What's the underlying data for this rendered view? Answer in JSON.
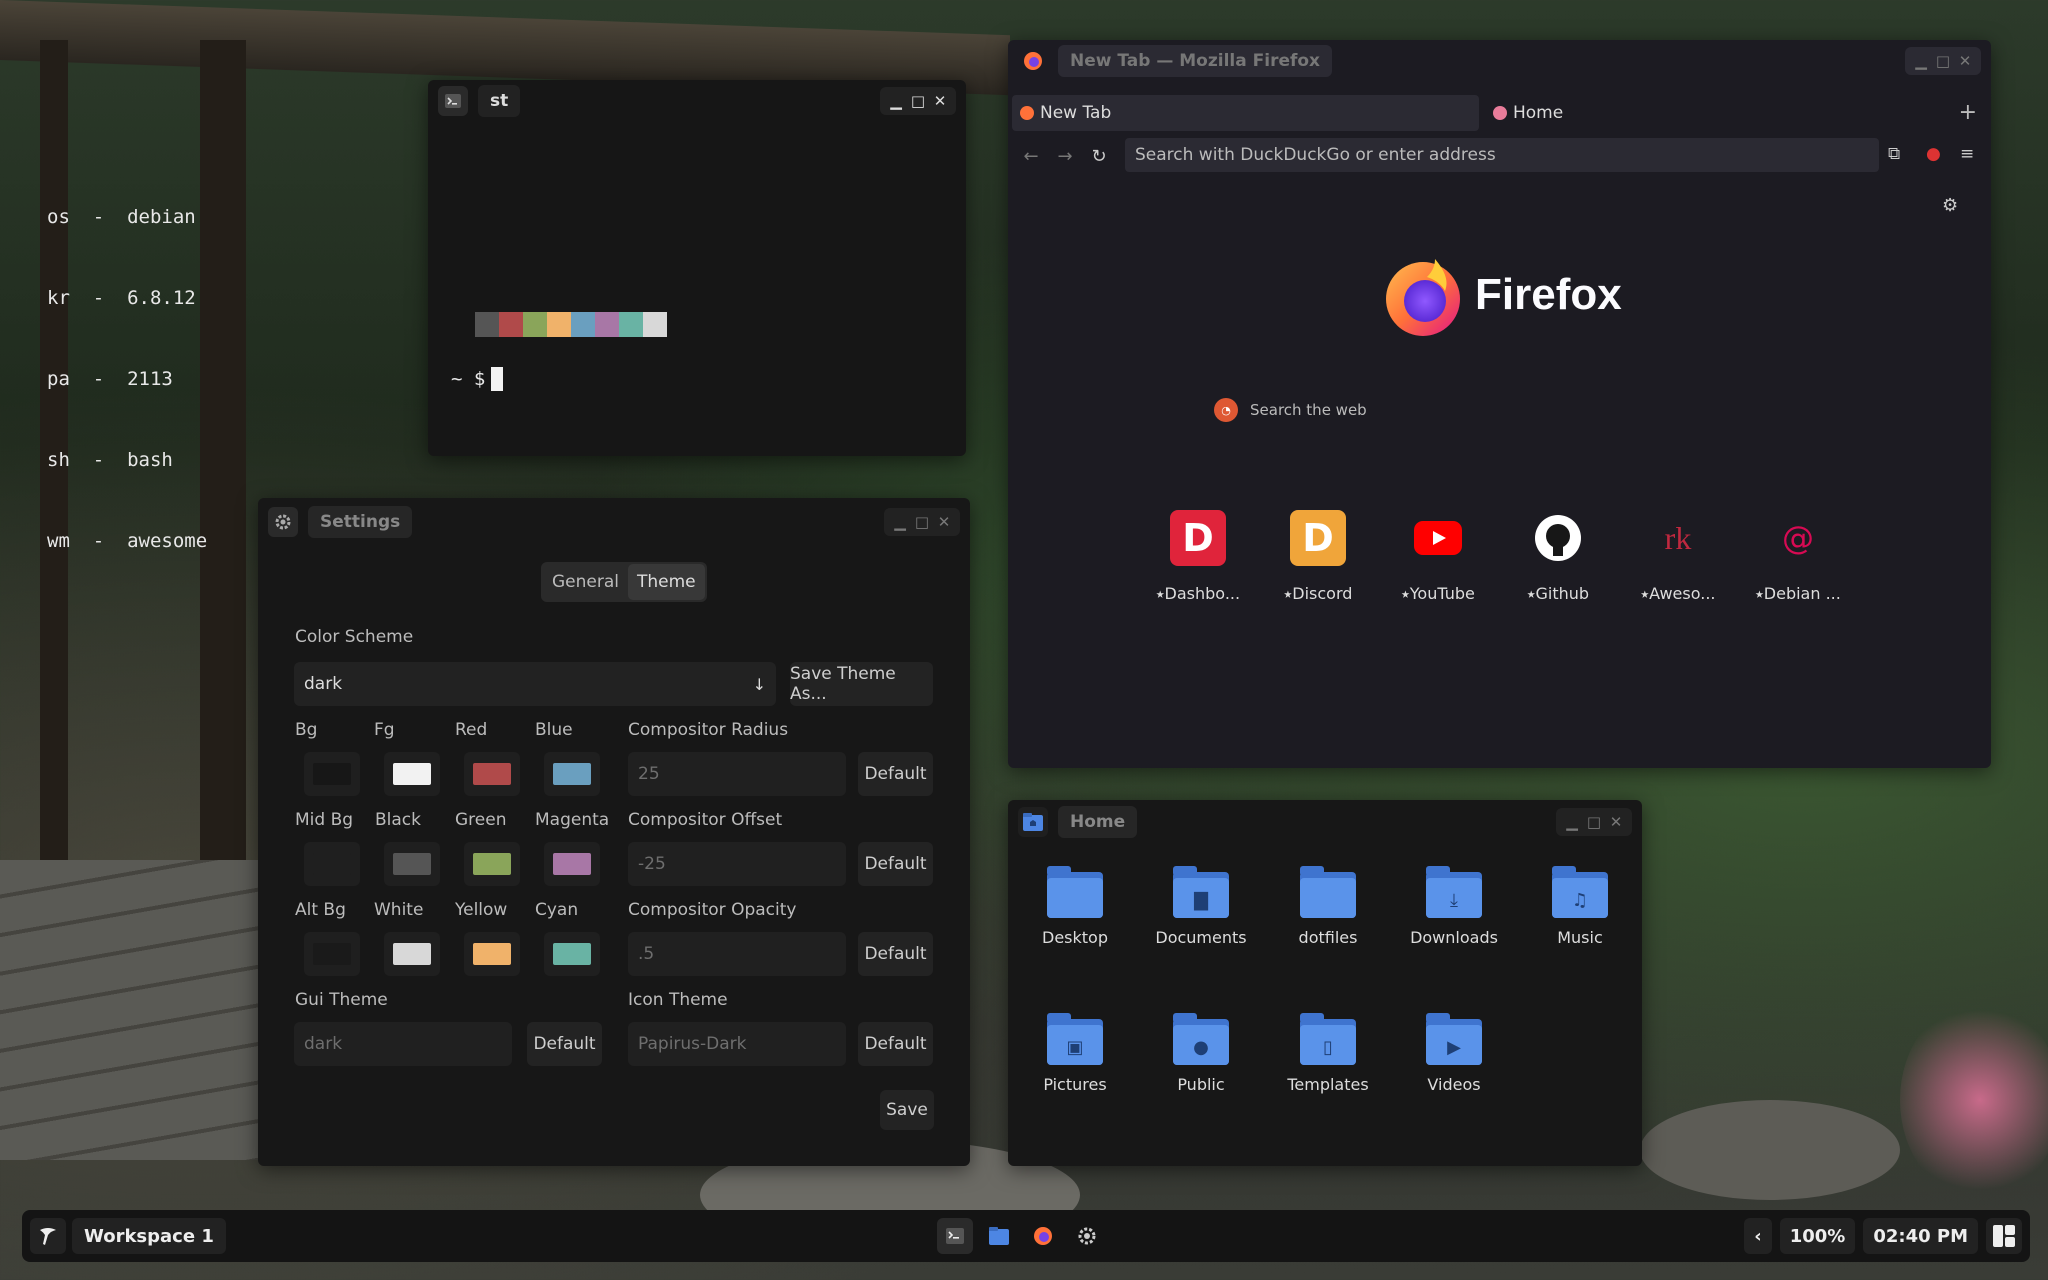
{
  "terminal": {
    "title": "st",
    "lines": [
      "os  -  debian",
      "kr  -  6.8.12",
      "pa  -  2113",
      "sh  -  bash",
      "wm  -  awesome"
    ],
    "palette": [
      "#555555",
      "#b04a4a",
      "#8aa55a",
      "#f0b26a",
      "#6a9fbf",
      "#a877a6",
      "#69b3a4",
      "#d8d8d8"
    ],
    "prompt": "~ $"
  },
  "settings": {
    "title": "Settings",
    "tabs": [
      "General",
      "Theme"
    ],
    "active_tab": "Theme",
    "color_scheme_label": "Color Scheme",
    "color_scheme_value": "dark",
    "save_theme_label": "Save Theme As...",
    "colors": {
      "bg": {
        "label": "Bg",
        "hex": "#171717"
      },
      "fg": {
        "label": "Fg",
        "hex": "#f2f2f2"
      },
      "red": {
        "label": "Red",
        "hex": "#b04a4a"
      },
      "blue": {
        "label": "Blue",
        "hex": "#6a9fbf"
      },
      "mid_bg": {
        "label": "Mid Bg",
        "hex": "#1f1f1f"
      },
      "black": {
        "label": "Black",
        "hex": "#555555"
      },
      "green": {
        "label": "Green",
        "hex": "#8aa55a"
      },
      "magenta": {
        "label": "Magenta",
        "hex": "#a877a6"
      },
      "alt_bg": {
        "label": "Alt Bg",
        "hex": "#1a1a1a"
      },
      "white": {
        "label": "White",
        "hex": "#d8d8d8"
      },
      "yellow": {
        "label": "Yellow",
        "hex": "#f0b26a"
      },
      "cyan": {
        "label": "Cyan",
        "hex": "#69b3a4"
      }
    },
    "compositor_radius_label": "Compositor Radius",
    "compositor_radius_value": "25",
    "compositor_offset_label": "Compositor Offset",
    "compositor_offset_value": "-25",
    "compositor_opacity_label": "Compositor Opacity",
    "compositor_opacity_value": ".5",
    "gui_theme_label": "Gui Theme",
    "gui_theme_value": "dark",
    "icon_theme_label": "Icon Theme",
    "icon_theme_value": "Papirus-Dark",
    "default_label": "Default",
    "save_label": "Save"
  },
  "firefox": {
    "window_title": "New Tab — Mozilla Firefox",
    "tabs": [
      {
        "label": "New Tab",
        "active": true
      },
      {
        "label": "Home",
        "active": false
      }
    ],
    "url_placeholder": "Search with DuckDuckGo or enter address",
    "wordmark": "Firefox",
    "search_placeholder": "Search the web",
    "shortcuts": [
      {
        "label": "Dashbo...",
        "color": "#e0243b",
        "glyph": "D"
      },
      {
        "label": "Discord",
        "color": "#f0a53a",
        "glyph": "D"
      },
      {
        "label": "YouTube",
        "color": "#ff0000",
        "glyph": "▶"
      },
      {
        "label": "Github",
        "color": "#ffffff",
        "glyph": "●"
      },
      {
        "label": "Aweso...",
        "color": "#c0283f",
        "glyph": "rk"
      },
      {
        "label": "Debian ...",
        "color": "#d70a53",
        "glyph": "@"
      }
    ]
  },
  "files": {
    "title": "Home",
    "items": [
      {
        "label": "Desktop",
        "glyph": ""
      },
      {
        "label": "Documents",
        "glyph": "▇"
      },
      {
        "label": "dotfiles",
        "glyph": ""
      },
      {
        "label": "Downloads",
        "glyph": "⤓"
      },
      {
        "label": "Music",
        "glyph": "♫"
      },
      {
        "label": "Pictures",
        "glyph": "▣"
      },
      {
        "label": "Public",
        "glyph": "●"
      },
      {
        "label": "Templates",
        "glyph": "▯"
      },
      {
        "label": "Videos",
        "glyph": "▶"
      }
    ]
  },
  "taskbar": {
    "workspace": "Workspace 1",
    "zoom": "100%",
    "time": "02:40 PM",
    "collapse_glyph": "‹"
  },
  "accent": "#4d86e3"
}
